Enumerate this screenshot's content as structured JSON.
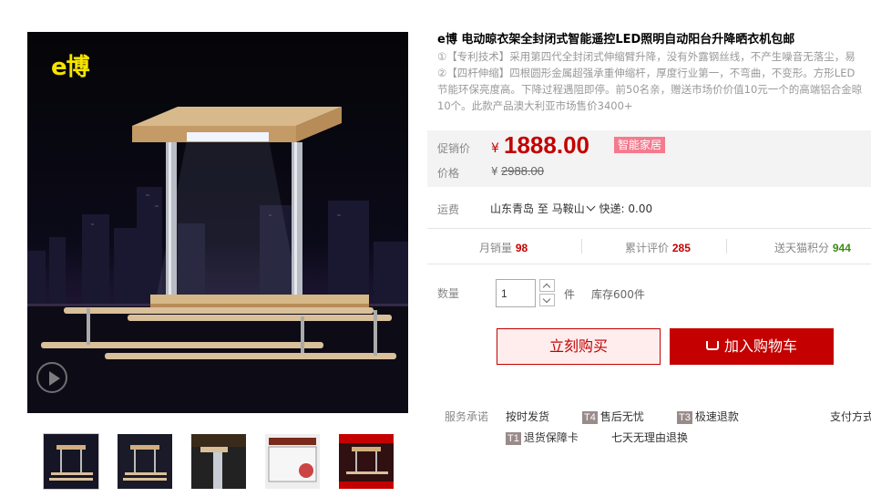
{
  "product": {
    "title": "e博 电动晾衣架全封闭式智能遥控LED照明自动阳台升降晒衣机包邮",
    "description": [
      "①【专利技术】采用第四代全封闭式伸缩臂升降，没有外露钢丝线，不产生噪音无落尘，易",
      "②【四杆伸缩】四根圆形金属超强承重伸缩杆，厚度行业第一，不弯曲，不变形。方形LED",
      "节能环保亮度高。下降过程遇阻即停。前50名亲，赠送市场价价值10元一个的高端铝合金晾",
      "10个。此款产品澳大利亚市场售价3400+"
    ],
    "brand_logo": "e博"
  },
  "price": {
    "label": "促销价",
    "currency": "¥",
    "value": "1888.00",
    "tag": "智能家居",
    "original_label": "价格",
    "original_value": "2988.00"
  },
  "shipping": {
    "label": "运费",
    "from": "山东青岛",
    "to_word": "至",
    "to": "马鞍山",
    "express": "快递: 0.00"
  },
  "stats": [
    {
      "label": "月销量",
      "value": "98",
      "color": "#c40000"
    },
    {
      "label": "累计评价",
      "value": "285",
      "color": "#c40000"
    },
    {
      "label": "送天猫积分",
      "value": "944",
      "color": "#3c8c14"
    }
  ],
  "quantity": {
    "label": "数量",
    "value": "1",
    "unit": "件",
    "stock": "库存600件"
  },
  "buttons": {
    "buy_now": "立刻购买",
    "add_to_cart": "加入购物车"
  },
  "services": {
    "label": "服务承诺",
    "items": [
      {
        "badge": "",
        "text": "按时发货"
      },
      {
        "badge": "T4",
        "text": "售后无忧"
      },
      {
        "badge": "T3",
        "text": "极速退款"
      },
      {
        "badge": "",
        "text": "支付方式"
      },
      {
        "badge": "T1",
        "text": "退货保障卡"
      },
      {
        "badge": "",
        "text": "七天无理由退换"
      }
    ]
  },
  "icons": {
    "play": "play-icon",
    "cart": "cart-icon",
    "chevron": "chevron-down-icon"
  },
  "colors": {
    "accent": "#c40000",
    "tag_bg": "#f57a8e",
    "price_bg": "#f3f3f3"
  }
}
